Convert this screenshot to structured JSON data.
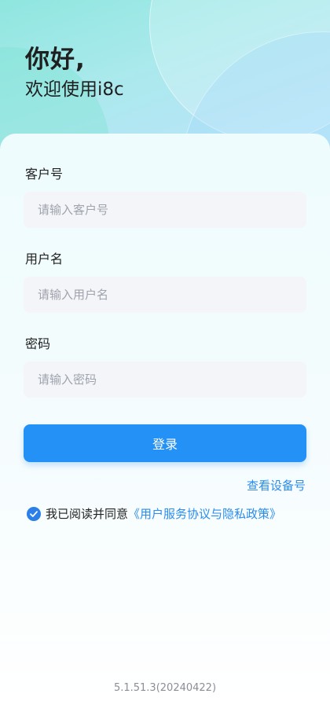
{
  "header": {
    "greeting": "你好,",
    "welcome": "欢迎使用i8c"
  },
  "form": {
    "customer_label": "客户号",
    "customer_placeholder": "请输入客户号",
    "username_label": "用户名",
    "username_placeholder": "请输入用户名",
    "password_label": "密码",
    "password_placeholder": "请输入密码"
  },
  "actions": {
    "login_label": "登录",
    "device_link": "查看设备号"
  },
  "agreement": {
    "checked": true,
    "prefix": "我已阅读并同意",
    "link": "《用户服务协议与隐私政策》"
  },
  "footer": {
    "version": "5.1.51.3(20240422)"
  },
  "colors": {
    "accent": "#2491f7",
    "link": "#2a8cef"
  },
  "icons": {
    "agree_check": "check-circle-icon"
  }
}
